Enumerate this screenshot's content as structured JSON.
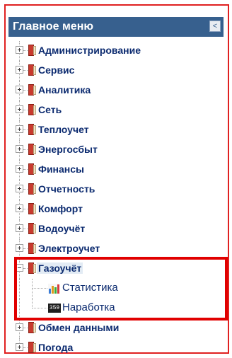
{
  "panel": {
    "title": "Главное меню",
    "collapse_button": "<"
  },
  "menu": [
    {
      "label": "Администрирование",
      "expanded": false
    },
    {
      "label": "Сервис",
      "expanded": false
    },
    {
      "label": "Аналитика",
      "expanded": false
    },
    {
      "label": "Сеть",
      "expanded": false
    },
    {
      "label": "Теплоучет",
      "expanded": false
    },
    {
      "label": "Энергосбыт",
      "expanded": false
    },
    {
      "label": "Финансы",
      "expanded": false
    },
    {
      "label": "Отчетность",
      "expanded": false
    },
    {
      "label": "Комфорт",
      "expanded": false
    },
    {
      "label": "Водоучёт",
      "expanded": false
    },
    {
      "label": "Электроучет",
      "expanded": false
    },
    {
      "label": "Газоучёт",
      "expanded": true,
      "selected": true,
      "children": [
        {
          "label": "Статистика",
          "icon": "bar-chart-icon"
        },
        {
          "label": "Наработка",
          "icon": "counter-icon",
          "icon_text": "359"
        }
      ]
    },
    {
      "label": "Обмен данными",
      "expanded": false
    },
    {
      "label": "Погода",
      "expanded": false
    }
  ],
  "colors": {
    "header_bg": "#37608e",
    "label_text": "#0b2a6f",
    "highlight_border": "#e10000",
    "outer_border": "#e02020"
  }
}
